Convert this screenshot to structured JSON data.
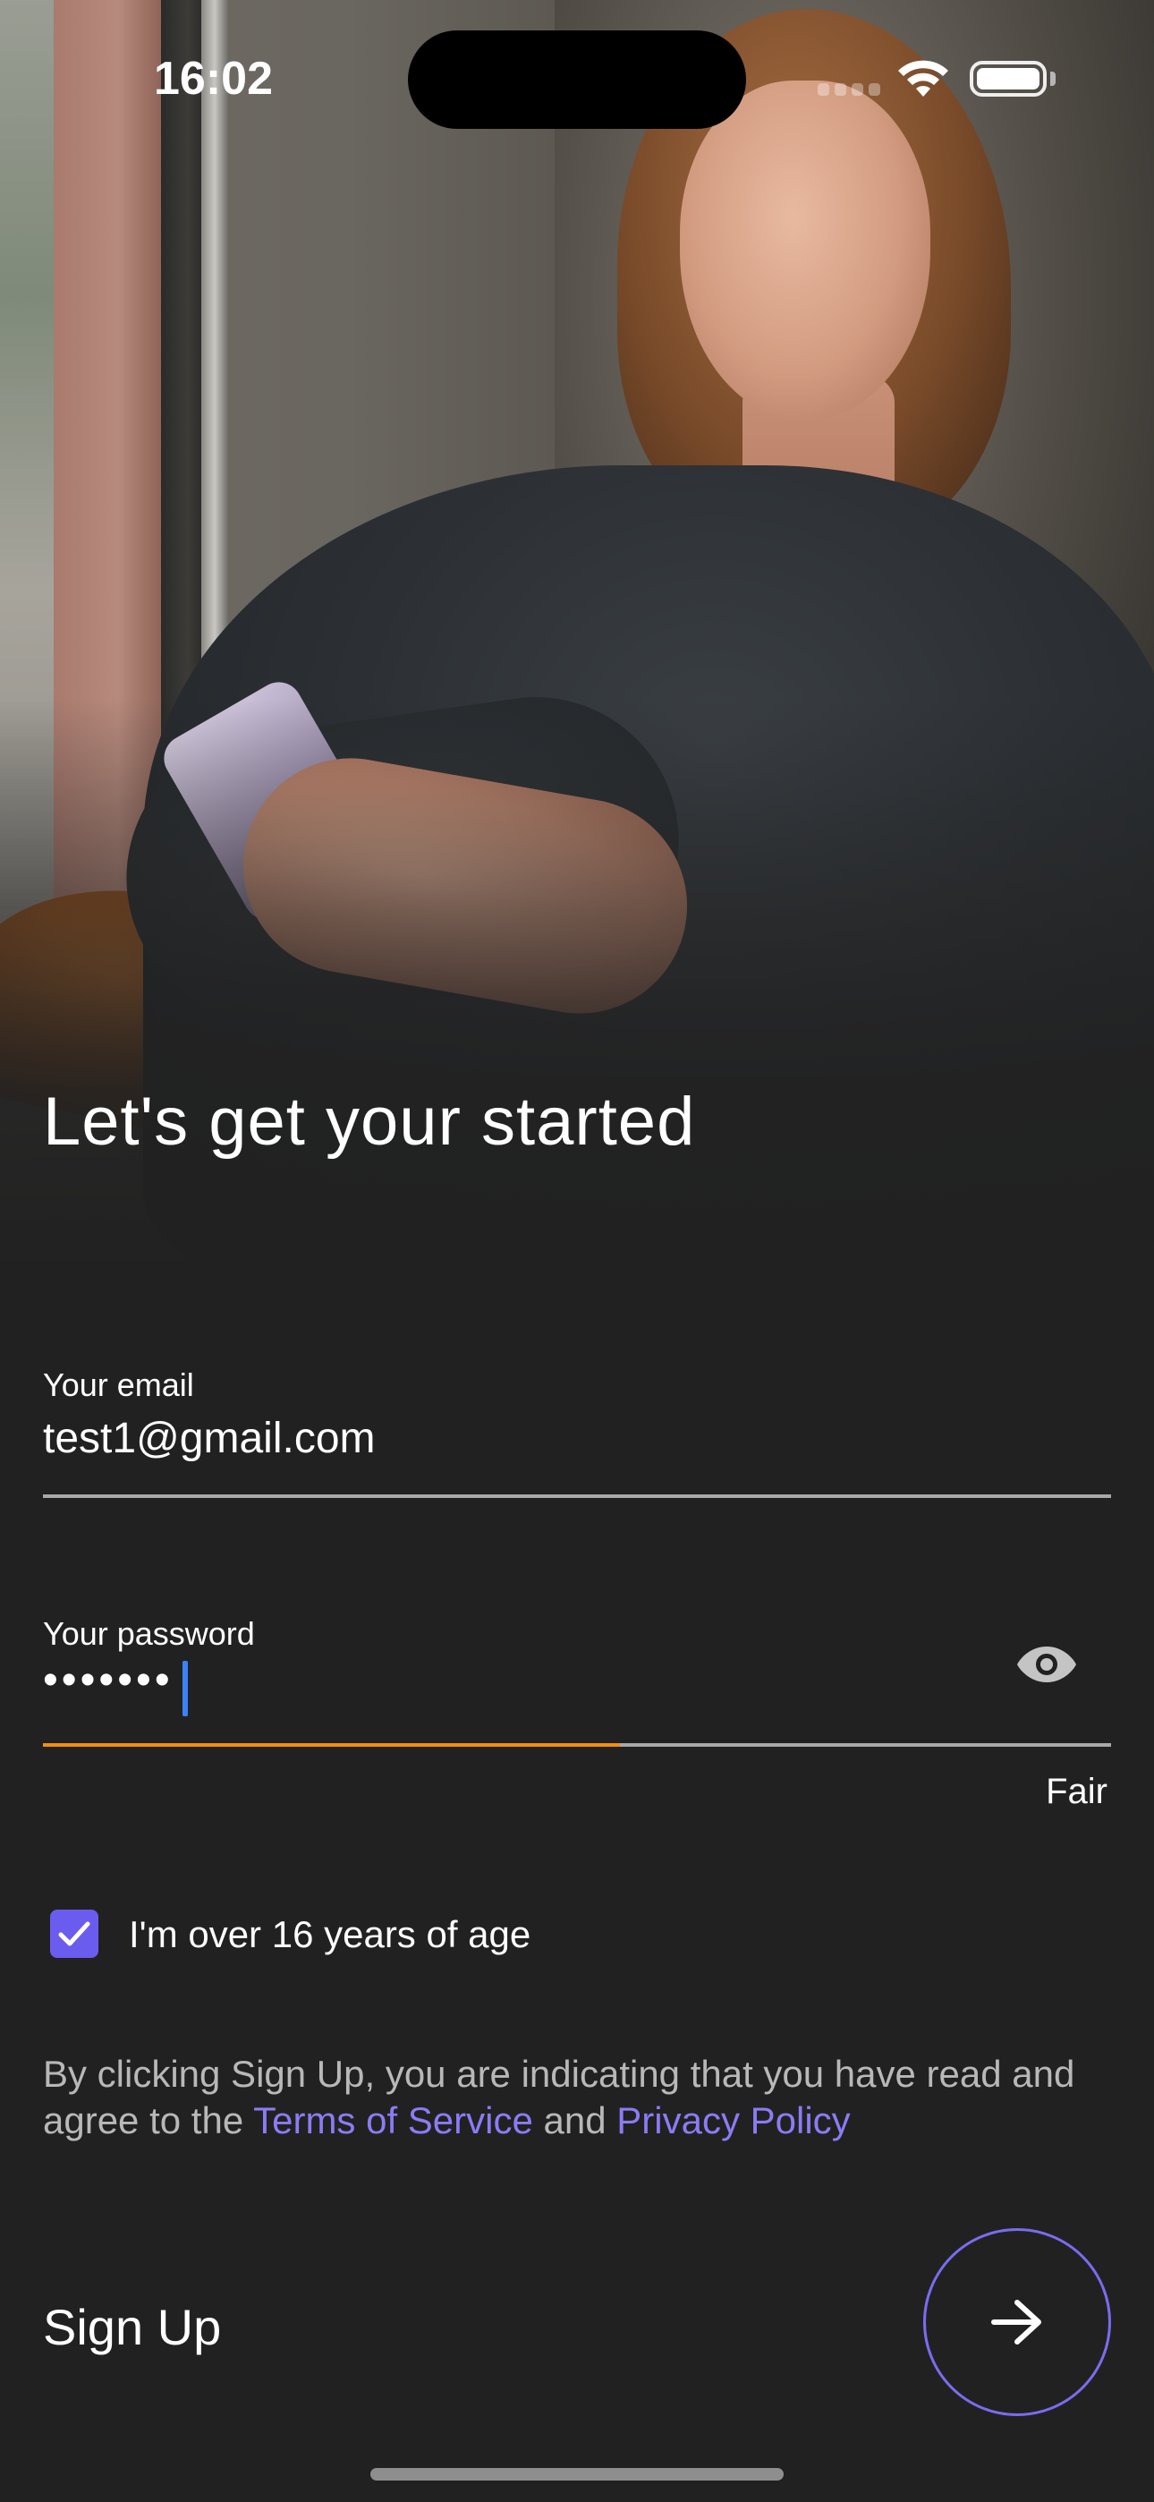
{
  "status_bar": {
    "time": "16:02"
  },
  "headline": "Let's get your started",
  "email": {
    "label": "Your email",
    "value": "test1@gmail.com"
  },
  "password": {
    "label": "Your password",
    "value": "•••••••",
    "strength_label": "Fair",
    "strength_fraction": 0.54,
    "strength_color": "#f5900a"
  },
  "age_check": {
    "label": "I'm over 16 years of age",
    "checked": true
  },
  "legal": {
    "prefix": "By clicking Sign Up, you are indicating that you have read and agree to the",
    "terms_link": "Terms of Service",
    "and": "and",
    "privacy_link": "Privacy Policy"
  },
  "signup": {
    "label": "Sign Up"
  },
  "colors": {
    "background": "#212121",
    "accent": "#6b5cf0",
    "link": "#8a7cf5",
    "caret": "#3b82f6"
  },
  "icons": {
    "eye": "eye-icon",
    "arrow": "arrow-right-icon",
    "check": "check-icon"
  }
}
